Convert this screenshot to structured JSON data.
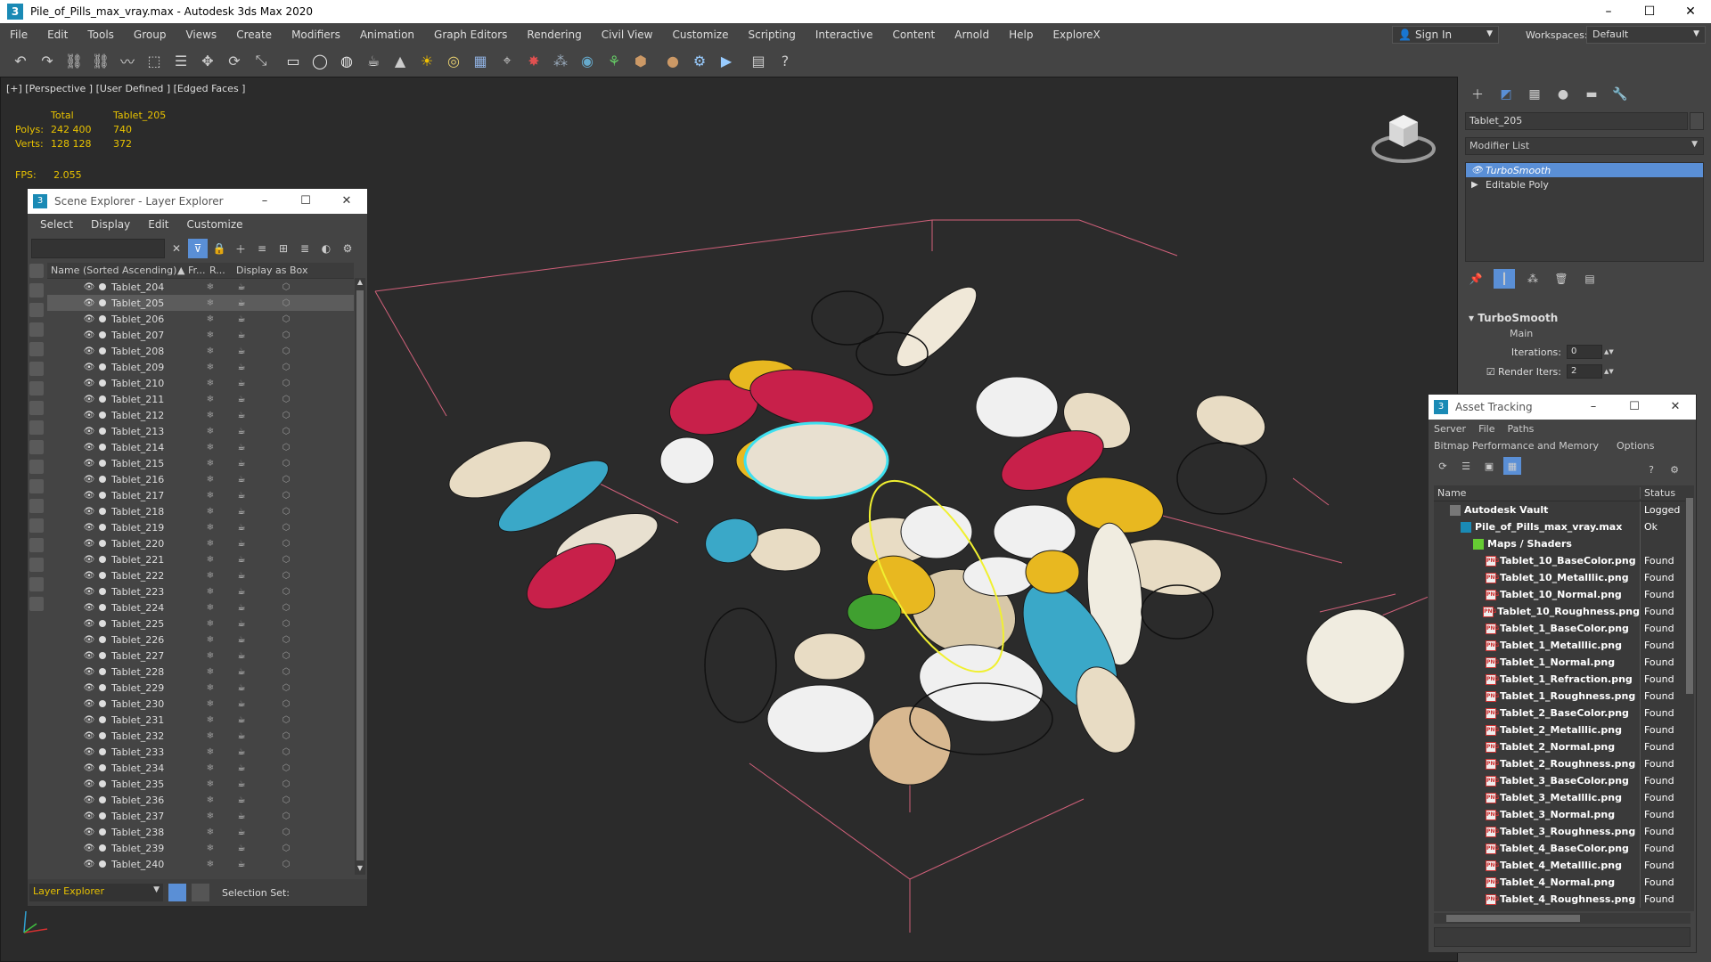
{
  "window": {
    "title": "Pile_of_Pills_max_vray.max - Autodesk 3ds Max 2020",
    "app_icon_glyph": "3",
    "minimize": "–",
    "maximize": "☐",
    "close": "✕"
  },
  "menubar": {
    "items": [
      "File",
      "Edit",
      "Tools",
      "Group",
      "Views",
      "Create",
      "Modifiers",
      "Animation",
      "Graph Editors",
      "Rendering",
      "Civil View",
      "Customize",
      "Scripting",
      "Interactive",
      "Content",
      "Arnold",
      "Help",
      "ExploreX"
    ],
    "signin": "Sign In",
    "workspaces_label": "Workspaces:",
    "workspaces_value": "Default"
  },
  "toolbar": {
    "icons": [
      "undo-icon",
      "redo-icon",
      "link-icon",
      "unlink-icon",
      "bind-space-warp-icon",
      "select-icon",
      "select-by-name-icon",
      "move-icon",
      "rotate-icon",
      "scale-icon",
      "plane-icon",
      "sphere-icon",
      "geosphere-icon",
      "teapot-icon",
      "cone-icon",
      "sun-icon",
      "torus-icon",
      "grid-icon",
      "camera-icon",
      "light-icon",
      "particles-icon",
      "shader-icon",
      "hair-icon",
      "proxy-icon",
      "material-sphere-icon",
      "render-setup-icon",
      "render-icon",
      "layers-icon",
      "help-icon"
    ]
  },
  "viewport": {
    "label": "[+] [Perspective ] [User Defined ] [Edged Faces ]",
    "stats": {
      "header": [
        "",
        "Total",
        "Tablet_205"
      ],
      "polys": [
        "Polys:",
        "242 400",
        "740"
      ],
      "verts": [
        "Verts:",
        "128 128",
        "372"
      ]
    },
    "fps_label": "FPS:",
    "fps_value": "2.055"
  },
  "scene_explorer": {
    "title": "Scene Explorer - Layer Explorer",
    "menu": [
      "Select",
      "Display",
      "Edit",
      "Customize"
    ],
    "columns": {
      "name": "Name (Sorted Ascending)",
      "frozen": "▲ Fr...",
      "render": "R...",
      "display_as_box": "Display as Box"
    },
    "rows": [
      "Tablet_204",
      "Tablet_205",
      "Tablet_206",
      "Tablet_207",
      "Tablet_208",
      "Tablet_209",
      "Tablet_210",
      "Tablet_211",
      "Tablet_212",
      "Tablet_213",
      "Tablet_214",
      "Tablet_215",
      "Tablet_216",
      "Tablet_217",
      "Tablet_218",
      "Tablet_219",
      "Tablet_220",
      "Tablet_221",
      "Tablet_222",
      "Tablet_223",
      "Tablet_224",
      "Tablet_225",
      "Tablet_226",
      "Tablet_227",
      "Tablet_228",
      "Tablet_229",
      "Tablet_230",
      "Tablet_231",
      "Tablet_232",
      "Tablet_233",
      "Tablet_234",
      "Tablet_235",
      "Tablet_236",
      "Tablet_237",
      "Tablet_238",
      "Tablet_239",
      "Tablet_240"
    ],
    "selected_row": "Tablet_205",
    "layer_dropdown": "Layer Explorer",
    "selection_set_label": "Selection Set:"
  },
  "command_panel": {
    "object_name": "Tablet_205",
    "modifier_list": "Modifier List",
    "stack": [
      {
        "label": "TurboSmooth",
        "selected": true
      },
      {
        "label": "Editable Poly",
        "selected": false
      }
    ],
    "rollout_title": "TurboSmooth",
    "rollout_section": "Main",
    "iterations_label": "Iterations:",
    "iterations_value": "0",
    "render_iters_label": "Render Iters:",
    "render_iters_value": "2"
  },
  "asset_tracking": {
    "title": "Asset Tracking",
    "menu1": [
      "Server",
      "File",
      "Paths"
    ],
    "menu2": [
      "Bitmap Performance and Memory",
      "Options"
    ],
    "columns": {
      "name": "Name",
      "status": "Status"
    },
    "rows": [
      {
        "name": "Autodesk Vault",
        "status": "Logged",
        "icon": "vault",
        "indent": 18
      },
      {
        "name": "Pile_of_Pills_max_vray.max",
        "status": "Ok",
        "icon": "max",
        "indent": 30
      },
      {
        "name": "Maps / Shaders",
        "status": "",
        "icon": "maps",
        "indent": 44
      },
      {
        "name": "Tablet_10_BaseColor.png",
        "status": "Found",
        "icon": "png",
        "indent": 58
      },
      {
        "name": "Tablet_10_Metalllic.png",
        "status": "Found",
        "icon": "png",
        "indent": 58
      },
      {
        "name": "Tablet_10_Normal.png",
        "status": "Found",
        "icon": "png",
        "indent": 58
      },
      {
        "name": "Tablet_10_Roughness.png",
        "status": "Found",
        "icon": "png",
        "indent": 58
      },
      {
        "name": "Tablet_1_BaseColor.png",
        "status": "Found",
        "icon": "png",
        "indent": 58
      },
      {
        "name": "Tablet_1_Metalllic.png",
        "status": "Found",
        "icon": "png",
        "indent": 58
      },
      {
        "name": "Tablet_1_Normal.png",
        "status": "Found",
        "icon": "png",
        "indent": 58
      },
      {
        "name": "Tablet_1_Refraction.png",
        "status": "Found",
        "icon": "png",
        "indent": 58
      },
      {
        "name": "Tablet_1_Roughness.png",
        "status": "Found",
        "icon": "png",
        "indent": 58
      },
      {
        "name": "Tablet_2_BaseColor.png",
        "status": "Found",
        "icon": "png",
        "indent": 58
      },
      {
        "name": "Tablet_2_Metalllic.png",
        "status": "Found",
        "icon": "png",
        "indent": 58
      },
      {
        "name": "Tablet_2_Normal.png",
        "status": "Found",
        "icon": "png",
        "indent": 58
      },
      {
        "name": "Tablet_2_Roughness.png",
        "status": "Found",
        "icon": "png",
        "indent": 58
      },
      {
        "name": "Tablet_3_BaseColor.png",
        "status": "Found",
        "icon": "png",
        "indent": 58
      },
      {
        "name": "Tablet_3_Metalllic.png",
        "status": "Found",
        "icon": "png",
        "indent": 58
      },
      {
        "name": "Tablet_3_Normal.png",
        "status": "Found",
        "icon": "png",
        "indent": 58
      },
      {
        "name": "Tablet_3_Roughness.png",
        "status": "Found",
        "icon": "png",
        "indent": 58
      },
      {
        "name": "Tablet_4_BaseColor.png",
        "status": "Found",
        "icon": "png",
        "indent": 58
      },
      {
        "name": "Tablet_4_Metalllic.png",
        "status": "Found",
        "icon": "png",
        "indent": 58
      },
      {
        "name": "Tablet_4_Normal.png",
        "status": "Found",
        "icon": "png",
        "indent": 58
      },
      {
        "name": "Tablet_4_Roughness.png",
        "status": "Found",
        "icon": "png",
        "indent": 58
      }
    ]
  },
  "colors": {
    "accent_selection": "#5a8fd6",
    "stats_yellow": "#e8c200",
    "grid_pink": "#d0607a",
    "selection_cyan": "#3ee0f0",
    "highlight_yellow": "#f0f030"
  }
}
